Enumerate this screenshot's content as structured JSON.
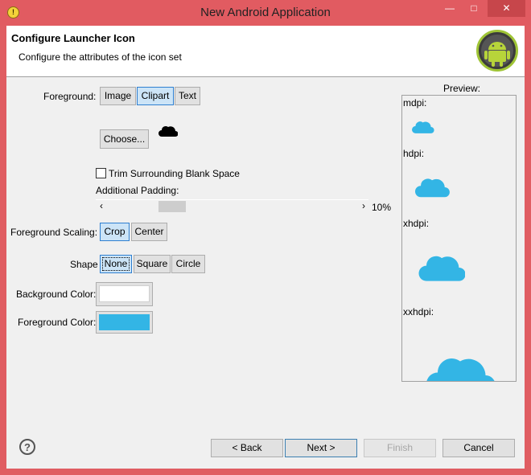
{
  "window": {
    "title": "New Android Application"
  },
  "header": {
    "title": "Configure Launcher Icon",
    "description": "Configure the attributes of the icon set"
  },
  "foreground": {
    "label": "Foreground:",
    "options": [
      "Image",
      "Clipart",
      "Text"
    ],
    "selected": "Clipart",
    "choose_label": "Choose..."
  },
  "trim": {
    "label": "Trim Surrounding Blank Space",
    "checked": false
  },
  "padding": {
    "label": "Additional Padding:",
    "value_text": "10%",
    "value": 10
  },
  "scaling": {
    "label": "Foreground Scaling:",
    "options": [
      "Crop",
      "Center"
    ],
    "selected": "Crop"
  },
  "shape": {
    "label": "Shape",
    "options": [
      "None",
      "Square",
      "Circle"
    ],
    "selected": "None"
  },
  "background_color": {
    "label": "Background Color:",
    "color": "#ffffff"
  },
  "foreground_color": {
    "label": "Foreground Color:",
    "color": "#33b5e5"
  },
  "preview": {
    "label": "Preview:",
    "densities": [
      "mdpi:",
      "hdpi:",
      "xhdpi:",
      "xxhdpi:"
    ]
  },
  "footer": {
    "back": "< Back",
    "next": "Next >",
    "finish": "Finish",
    "cancel": "Cancel"
  },
  "icons": {
    "app": "android-adt-icon",
    "banner": "android-robot-icon",
    "clipart": "cloud-icon",
    "help": "help-icon"
  }
}
